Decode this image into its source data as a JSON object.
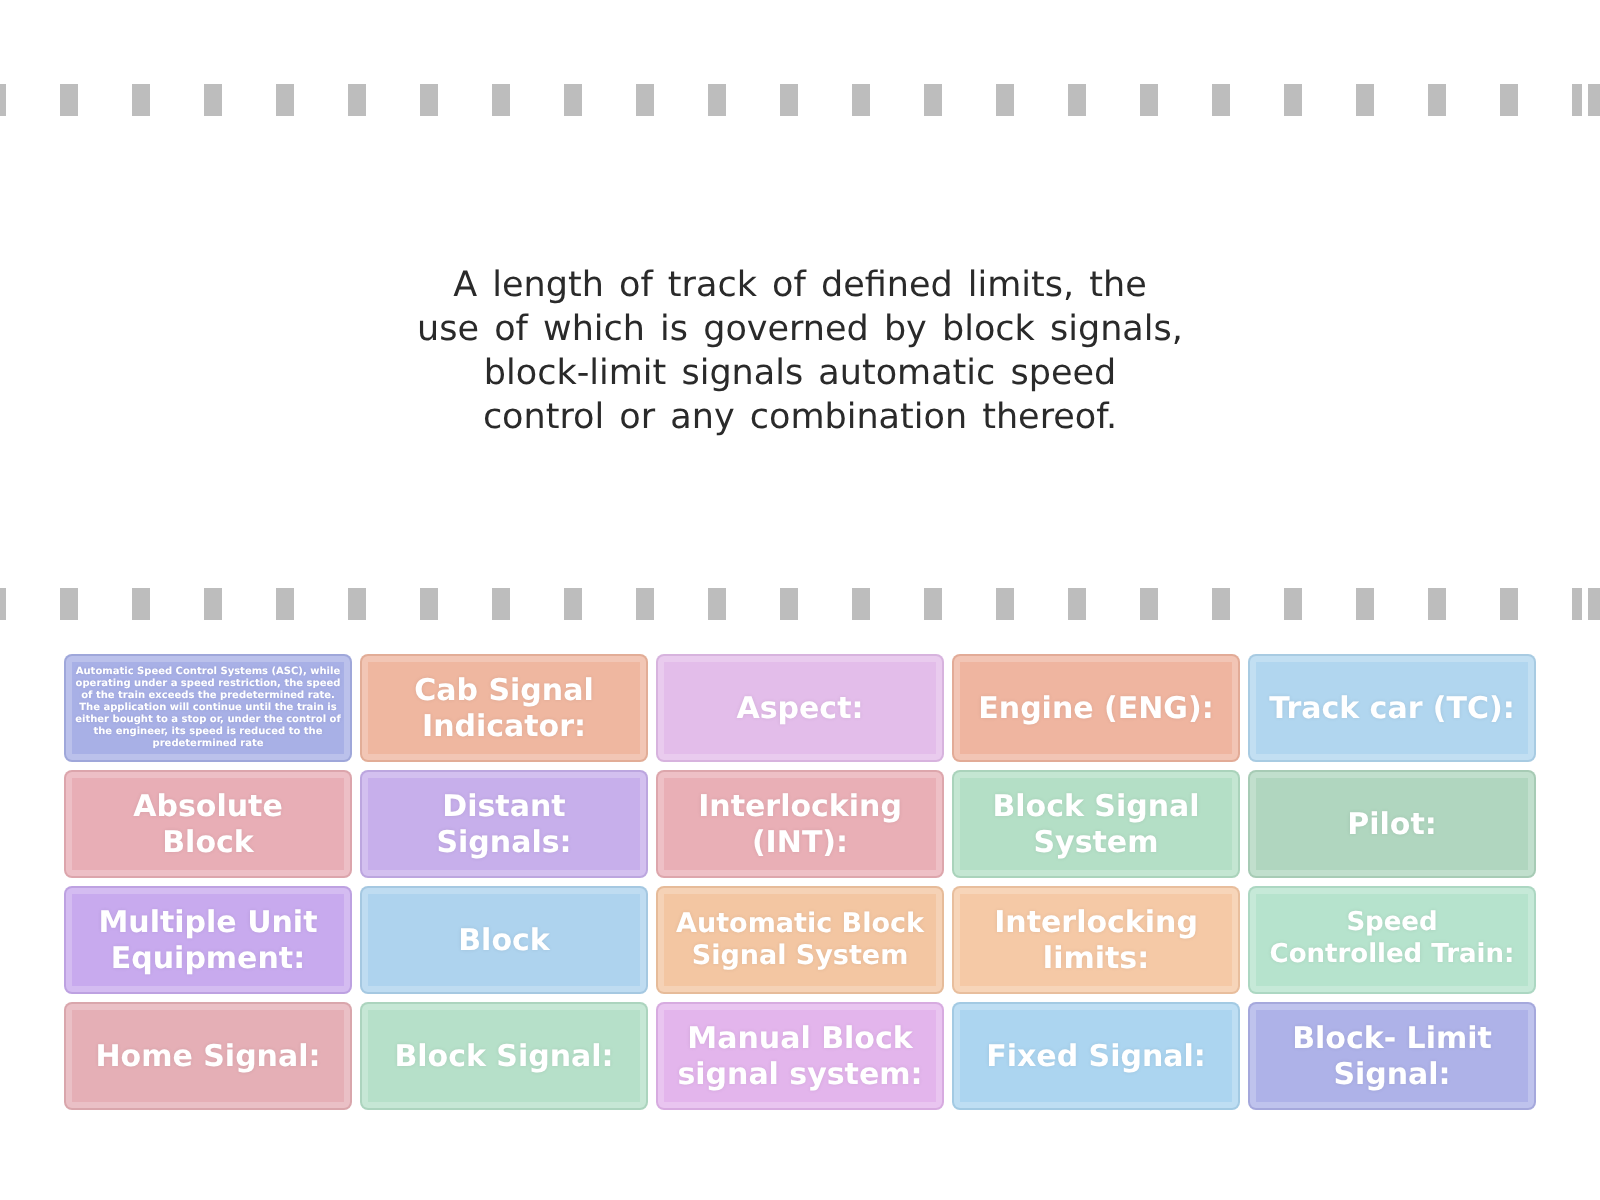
{
  "definition": "A length of track of defined limits, the use of which is governed by block signals, block-limit signals automatic speed control or any combination thereof.",
  "tiles": [
    {
      "text": "Automatic Speed Control Systems (ASC), while operating under a speed restriction, the speed of the train exceeds the predetermined rate. The application will continue until the train is either bought to a stop or, under the control of the engineer, its speed is reduced to the predetermined rate",
      "color": "#a8b0e6"
    },
    {
      "text": "Cab Signal Indicator:",
      "color": "#efb7a0"
    },
    {
      "text": "Aspect:",
      "color": "#e3bdea"
    },
    {
      "text": "Engine (ENG):",
      "color": "#efb5a0"
    },
    {
      "text": "Track car (TC):",
      "color": "#b1d6ef"
    },
    {
      "text": "Absolute Block",
      "color": "#e8aeb6"
    },
    {
      "text": "Distant Signals:",
      "color": "#c7afeb"
    },
    {
      "text": "Interlocking (INT):",
      "color": "#e9afb6"
    },
    {
      "text": "Block Signal System",
      "color": "#b4dfc6"
    },
    {
      "text": "Pilot:",
      "color": "#b0d6bf"
    },
    {
      "text": "Multiple Unit Equipment:",
      "color": "#c8aaee"
    },
    {
      "text": "Block",
      "color": "#aed3ee"
    },
    {
      "text": "Automatic Block Signal System",
      "color": "#f3c6a2"
    },
    {
      "text": "Interlocking limits:",
      "color": "#f5c9a6"
    },
    {
      "text": "Speed Controlled Train:",
      "color": "#b6e3cd"
    },
    {
      "text": "Home Signal:",
      "color": "#e5afb6"
    },
    {
      "text": "Block Signal:",
      "color": "#b6e0c9"
    },
    {
      "text": "Manual Block signal system:",
      "color": "#e3b5ec"
    },
    {
      "text": "Fixed Signal:",
      "color": "#acd5f0"
    },
    {
      "text": "Block- Limit Signal:",
      "color": "#aeb2e8"
    }
  ]
}
